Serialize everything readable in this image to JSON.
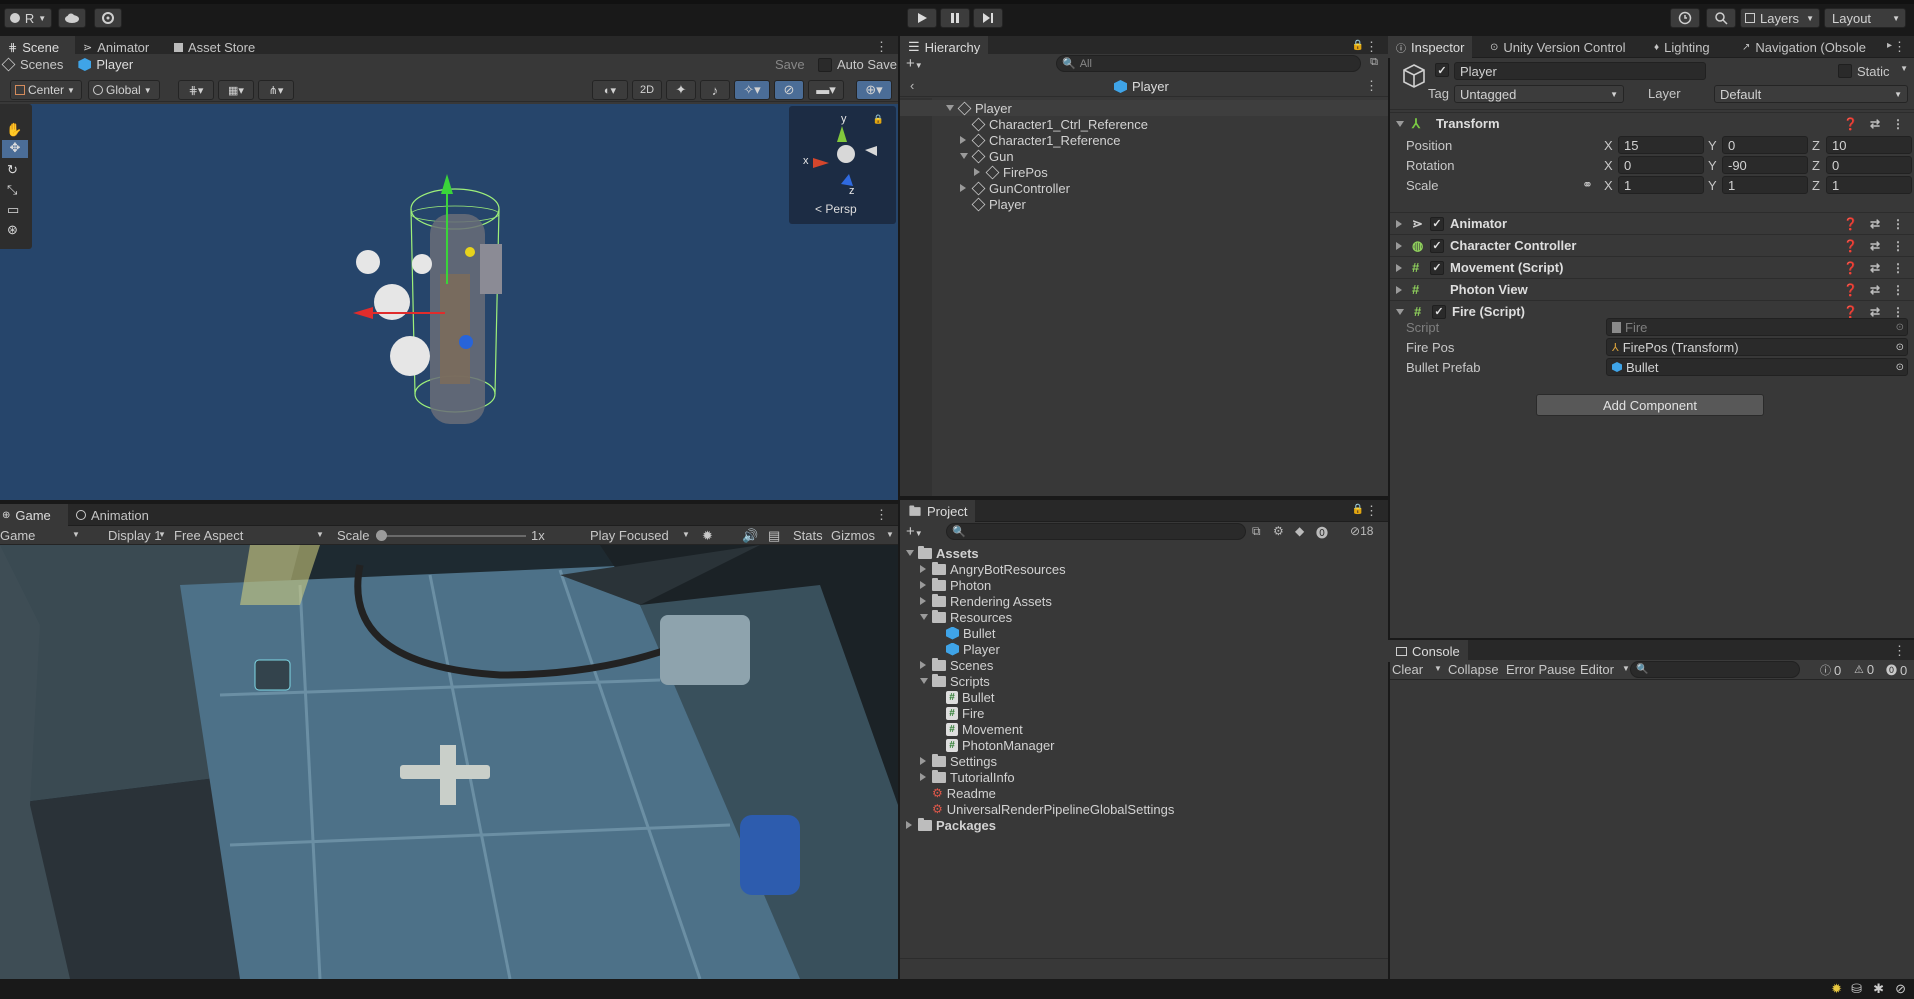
{
  "toolbar": {
    "account": "R",
    "layers": "Layers",
    "layout": "Layout"
  },
  "scene_panel": {
    "tabs": [
      "Scene",
      "Animator",
      "Asset Store"
    ],
    "breadcrumb": [
      "Scenes",
      "Player"
    ],
    "save": "Save",
    "auto_save": "Auto Save",
    "pivot": "Center",
    "space": "Global",
    "mode_2d": "2D",
    "gizmo_persp": "Persp",
    "gizmo_axes": {
      "y": "y",
      "x": "x",
      "z": "z"
    }
  },
  "game_panel": {
    "tabs": [
      "Game",
      "Animation"
    ],
    "display_mode": "Game",
    "display": "Display 1",
    "aspect": "Free Aspect",
    "scale_label": "Scale",
    "scale_value": "1x",
    "play_focused": "Play Focused",
    "stats": "Stats",
    "gizmos": "Gizmos"
  },
  "hierarchy": {
    "tab": "Hierarchy",
    "search_placeholder": "All",
    "prefab_title": "Player",
    "items": [
      {
        "label": "Player",
        "depth": 0,
        "expanded": true
      },
      {
        "label": "Character1_Ctrl_Reference",
        "depth": 1,
        "expanded": null
      },
      {
        "label": "Character1_Reference",
        "depth": 1,
        "expanded": false
      },
      {
        "label": "Gun",
        "depth": 1,
        "expanded": true
      },
      {
        "label": "FirePos",
        "depth": 2,
        "expanded": false
      },
      {
        "label": "GunController",
        "depth": 1,
        "expanded": false
      },
      {
        "label": "Player",
        "depth": 1,
        "expanded": null
      }
    ]
  },
  "project": {
    "tab": "Project",
    "hidden_count": "18",
    "items": [
      {
        "label": "Assets",
        "depth": 0,
        "type": "folder",
        "expanded": true,
        "bold": true
      },
      {
        "label": "AngryBotResources",
        "depth": 1,
        "type": "folder",
        "expanded": false
      },
      {
        "label": "Photon",
        "depth": 1,
        "type": "folder",
        "expanded": false
      },
      {
        "label": "Rendering Assets",
        "depth": 1,
        "type": "folder",
        "expanded": false
      },
      {
        "label": "Resources",
        "depth": 1,
        "type": "folder",
        "expanded": true
      },
      {
        "label": "Bullet",
        "depth": 2,
        "type": "prefab"
      },
      {
        "label": "Player",
        "depth": 2,
        "type": "prefab"
      },
      {
        "label": "Scenes",
        "depth": 1,
        "type": "folder",
        "expanded": false
      },
      {
        "label": "Scripts",
        "depth": 1,
        "type": "folder",
        "expanded": true
      },
      {
        "label": "Bullet",
        "depth": 2,
        "type": "script"
      },
      {
        "label": "Fire",
        "depth": 2,
        "type": "script"
      },
      {
        "label": "Movement",
        "depth": 2,
        "type": "script"
      },
      {
        "label": "PhotonManager",
        "depth": 2,
        "type": "script"
      },
      {
        "label": "Settings",
        "depth": 1,
        "type": "folder",
        "expanded": false
      },
      {
        "label": "TutorialInfo",
        "depth": 1,
        "type": "folder",
        "expanded": false
      },
      {
        "label": "Readme",
        "depth": 1,
        "type": "asset"
      },
      {
        "label": "UniversalRenderPipelineGlobalSettings",
        "depth": 1,
        "type": "asset"
      },
      {
        "label": "Packages",
        "depth": 0,
        "type": "folder",
        "expanded": false,
        "bold": true
      }
    ]
  },
  "inspector": {
    "tabs": [
      "Inspector",
      "Unity Version Control",
      "Lighting",
      "Navigation (Obsole"
    ],
    "object_name": "Player",
    "static": "Static",
    "tag_label": "Tag",
    "tag_value": "Untagged",
    "layer_label": "Layer",
    "layer_value": "Default",
    "transform": {
      "title": "Transform",
      "position_label": "Position",
      "rotation_label": "Rotation",
      "scale_label": "Scale",
      "axis_x": "X",
      "axis_y": "Y",
      "axis_z": "Z",
      "position": [
        "15",
        "0",
        "10"
      ],
      "rotation": [
        "0",
        "-90",
        "0"
      ],
      "scale": [
        "1",
        "1",
        "1"
      ]
    },
    "components": [
      "Animator",
      "Character Controller",
      "Movement (Script)",
      "Photon View",
      "Fire (Script)"
    ],
    "fire": {
      "script_label": "Script",
      "script_value": "Fire",
      "firepos_label": "Fire Pos",
      "firepos_value": "FirePos (Transform)",
      "bullet_label": "Bullet Prefab",
      "bullet_value": "Bullet"
    },
    "add_component": "Add Component"
  },
  "console": {
    "tab": "Console",
    "clear": "Clear",
    "collapse": "Collapse",
    "error_pause": "Error Pause",
    "editor": "Editor",
    "log_count": "0",
    "warn_count": "0",
    "error_count": "0"
  },
  "colors": {
    "scene_bg": "#26456b",
    "panel": "#383838",
    "accent": "#3a79bb"
  }
}
